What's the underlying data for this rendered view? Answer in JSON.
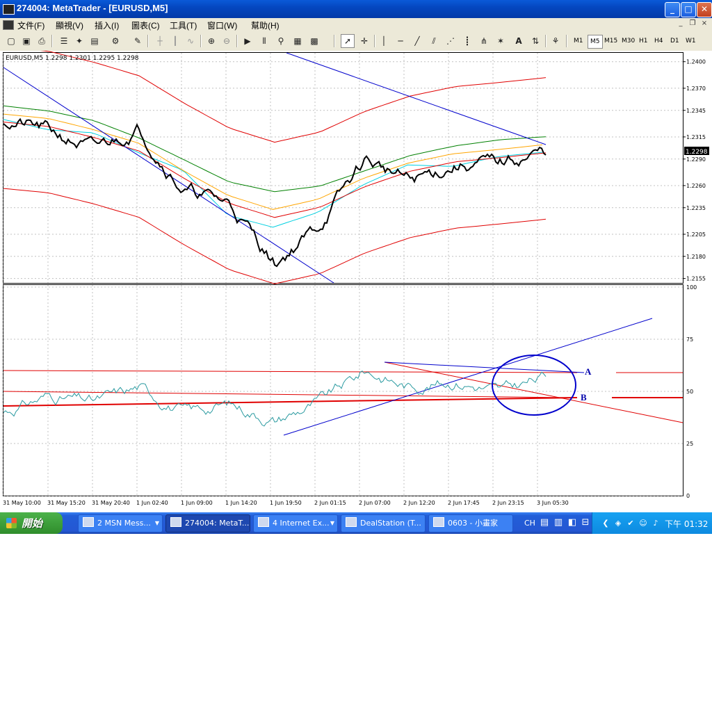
{
  "window": {
    "title": "274004: MetaTrader - [EURUSD,M5]",
    "minimize_glyph": "_",
    "maximize_glyph": "□",
    "close_glyph": "✕"
  },
  "menu": {
    "items": [
      {
        "label": "文件(F)"
      },
      {
        "label": "顯視(V)"
      },
      {
        "label": "插入(I)"
      },
      {
        "label": "圖表(C)"
      },
      {
        "label": "工具(T)"
      },
      {
        "label": "窗口(W)"
      },
      {
        "label": "幫助(H)"
      }
    ],
    "mdi_minimize": "_",
    "mdi_restore": "❐",
    "mdi_close": "×"
  },
  "toolbar": {
    "timeframes": [
      "M1",
      "M5",
      "M15",
      "M30",
      "H1",
      "H4",
      "D1",
      "W1"
    ],
    "active_timeframe": "M5",
    "text_tool_label": "A"
  },
  "chart": {
    "symbol_header": "EURUSD,M5  1.2298 1.2301 1.2295 1.2298",
    "current_price": "1.2298",
    "price_ticks": [
      "1.2400",
      "1.2370",
      "1.2345",
      "1.2315",
      "1.2290",
      "1.2260",
      "1.2235",
      "1.2205",
      "1.2180",
      "1.2155"
    ],
    "indicator_ticks": [
      "100",
      "75",
      "50",
      "25",
      "0"
    ],
    "time_ticks": [
      "31 May 10:00",
      "31 May 15:20",
      "31 May 20:40",
      "1 Jun 02:40",
      "1 Jun 09:00",
      "1 Jun 14:20",
      "1 Jun 19:50",
      "2 Jun 01:15",
      "2 Jun 07:00",
      "2 Jun 12:20",
      "2 Jun 17:45",
      "2 Jun 23:15",
      "3 Jun 05:30"
    ],
    "annotation_a": "A",
    "annotation_b": "B",
    "colors": {
      "price": "#000000",
      "indicator": "#2a9aa0",
      "upper_band": "#e00000",
      "trend_blue": "#0000cc",
      "ma_green": "#008000",
      "ma_orange": "#ffa500",
      "ma_cyan": "#00d0e0",
      "circle": "#0000cc"
    }
  },
  "chart_data": [
    {
      "type": "line",
      "title": "EURUSD,M5",
      "ylim": [
        1.215,
        1.241
      ],
      "x": [
        "31 May 10:00",
        "31 May 15:20",
        "31 May 20:40",
        "1 Jun 02:40",
        "1 Jun 09:00",
        "1 Jun 14:20",
        "1 Jun 19:50",
        "2 Jun 01:15",
        "2 Jun 07:00",
        "2 Jun 12:20",
        "2 Jun 17:45",
        "2 Jun 23:15",
        "3 Jun 05:30"
      ],
      "series": [
        {
          "name": "EURUSD",
          "values": [
            1.2335,
            1.2322,
            1.23,
            1.2325,
            1.2255,
            1.224,
            1.2172,
            1.2215,
            1.229,
            1.2265,
            1.2283,
            1.2285,
            1.2298
          ]
        }
      ]
    },
    {
      "type": "line",
      "ylim": [
        0,
        100
      ],
      "x": [
        "31 May 10:00",
        "31 May 15:20",
        "31 May 20:40",
        "1 Jun 02:40",
        "1 Jun 09:00",
        "1 Jun 14:20",
        "1 Jun 19:50",
        "2 Jun 01:15",
        "2 Jun 07:00",
        "2 Jun 12:20",
        "2 Jun 17:45",
        "2 Jun 23:15",
        "3 Jun 05:30"
      ],
      "series": [
        {
          "values": [
            40,
            48,
            45,
            52,
            40,
            44,
            36,
            45,
            60,
            52,
            55,
            50,
            57
          ]
        }
      ]
    }
  ],
  "taskbar": {
    "start_label": "開始",
    "tasks": [
      {
        "label": "2 MSN Mess..."
      },
      {
        "label": "274004: MetaT..."
      },
      {
        "label": "4 Internet Ex..."
      },
      {
        "label": "DealStation (T..."
      },
      {
        "label": "0603 - 小畫家"
      }
    ],
    "language": "CH",
    "clock": "下午 01:32"
  }
}
